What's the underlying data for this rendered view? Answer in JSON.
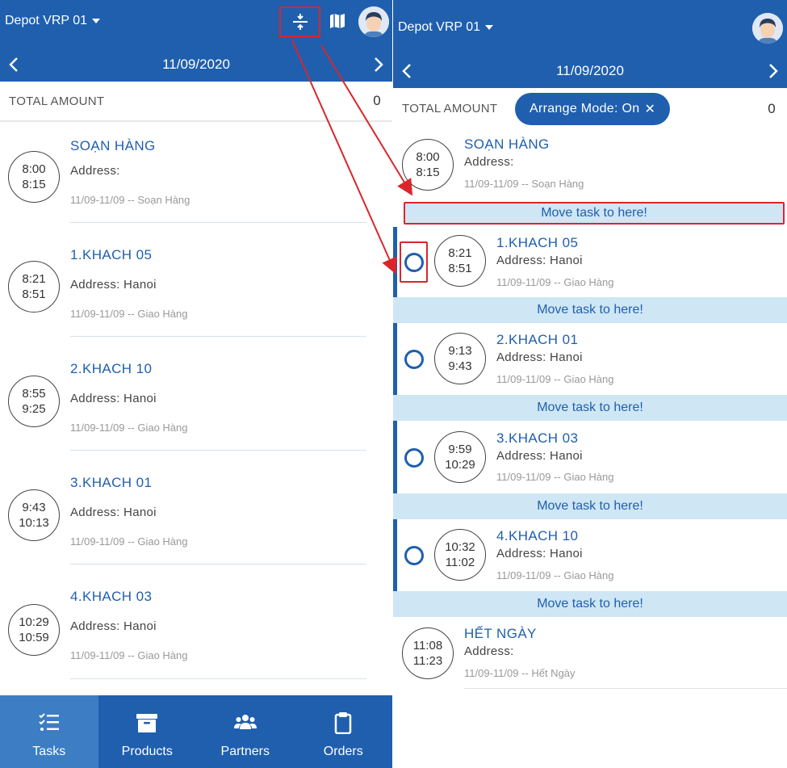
{
  "left": {
    "depot": "Depot VRP 01",
    "date": "11/09/2020",
    "total_label": "TOTAL AMOUNT",
    "total_value": "0",
    "tasks": [
      {
        "start": "8:00",
        "end": "8:15",
        "title": "SOẠN HÀNG",
        "address": "Address:",
        "meta": "11/09-11/09 -- Soạn Hàng"
      },
      {
        "start": "8:21",
        "end": "8:51",
        "title": "1.KHACH 05",
        "address": "Address: Hanoi",
        "meta": "11/09-11/09 -- Giao Hàng"
      },
      {
        "start": "8:55",
        "end": "9:25",
        "title": "2.KHACH 10",
        "address": "Address: Hanoi",
        "meta": "11/09-11/09 -- Giao Hàng"
      },
      {
        "start": "9:43",
        "end": "10:13",
        "title": "3.KHACH 01",
        "address": "Address: Hanoi",
        "meta": "11/09-11/09 -- Giao Hàng"
      },
      {
        "start": "10:29",
        "end": "10:59",
        "title": "4.KHACH 03",
        "address": "Address: Hanoi",
        "meta": "11/09-11/09 -- Giao Hàng"
      }
    ],
    "tabs": [
      {
        "label": "Tasks",
        "icon": "tasks-icon"
      },
      {
        "label": "Products",
        "icon": "archive-box-icon"
      },
      {
        "label": "Partners",
        "icon": "users-icon"
      },
      {
        "label": "Orders",
        "icon": "clipboard-icon"
      }
    ]
  },
  "right": {
    "depot": "Depot VRP 01",
    "date": "11/09/2020",
    "total_label": "TOTAL AMOUNT",
    "total_value": "0",
    "arrange_chip": "Arrange Mode: On",
    "move_label": "Move task to here!",
    "first_task": {
      "start": "8:00",
      "end": "8:15",
      "title": "SOẠN HÀNG",
      "address": "Address:",
      "meta": "11/09-11/09 -- Soạn Hàng"
    },
    "tasks": [
      {
        "start": "8:21",
        "end": "8:51",
        "title": "1.KHACH 05",
        "address": "Address: Hanoi",
        "meta": "11/09-11/09 -- Giao Hàng"
      },
      {
        "start": "9:13",
        "end": "9:43",
        "title": "2.KHACH 01",
        "address": "Address: Hanoi",
        "meta": "11/09-11/09 -- Giao Hàng"
      },
      {
        "start": "9:59",
        "end": "10:29",
        "title": "3.KHACH 03",
        "address": "Address: Hanoi",
        "meta": "11/09-11/09 -- Giao Hàng"
      },
      {
        "start": "10:32",
        "end": "11:02",
        "title": "4.KHACH 10",
        "address": "Address: Hanoi",
        "meta": "11/09-11/09 -- Giao Hàng"
      }
    ],
    "last_task": {
      "start": "11:08",
      "end": "11:23",
      "title": "HẾT NGÀY",
      "address": "Address:",
      "meta": "11/09-11/09 -- Hết Ngày"
    }
  },
  "colors": {
    "primary": "#1f5fae",
    "tab_active": "#3c7dc4",
    "drop_zone": "#cfe6f5",
    "annotation": "#d9262c"
  }
}
